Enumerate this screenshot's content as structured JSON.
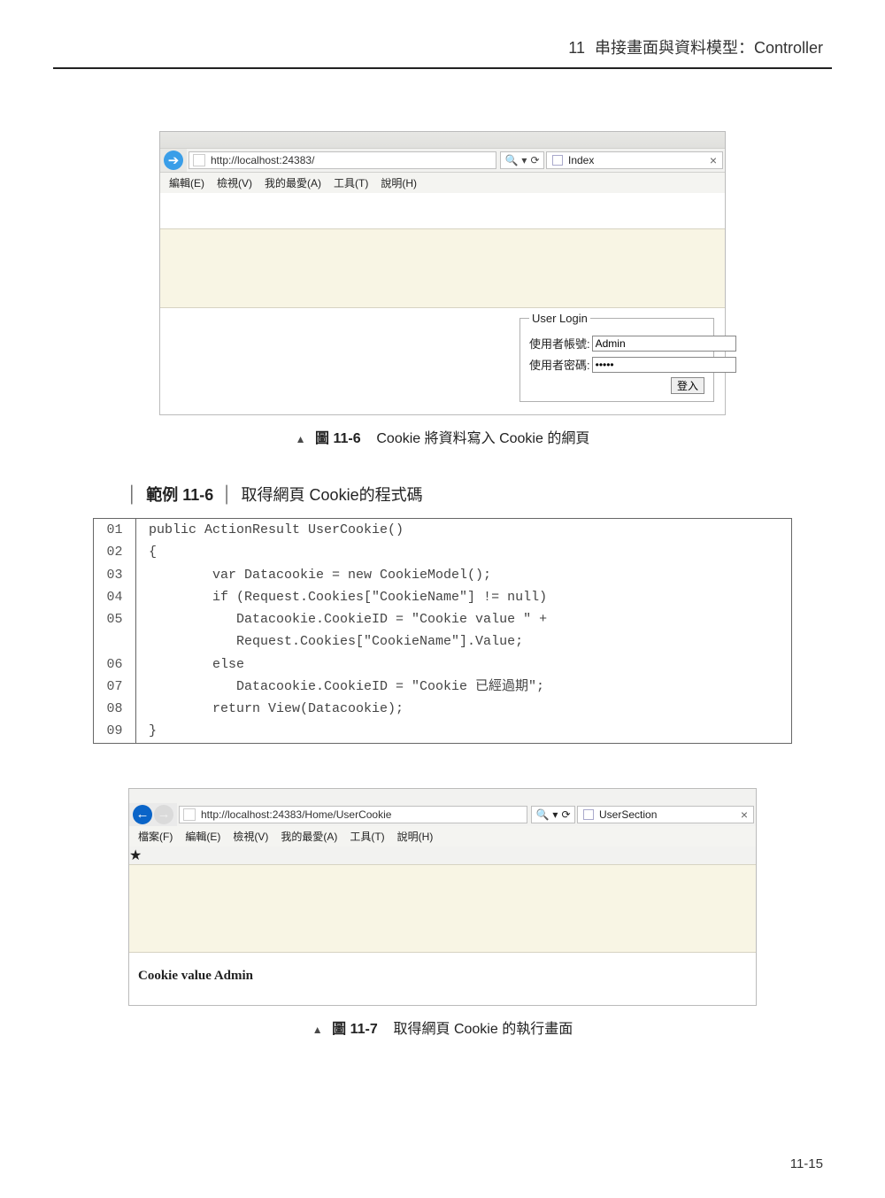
{
  "header": {
    "chapter_num": "11",
    "chapter_title": "串接畫面與資料模型：Controller"
  },
  "page_number": "11-15",
  "fig1": {
    "url_prefix": "http://",
    "url_host": "localhost",
    "url_rest": ":24383/",
    "search_refresh": "⟳",
    "tab_title": "Index",
    "menu": [
      "編輯(E)",
      "檢視(V)",
      "我的最愛(A)",
      "工具(T)",
      "說明(H)"
    ],
    "login_legend": "User Login",
    "label_user": "使用者帳號:",
    "label_pass": "使用者密碼:",
    "value_user": "Admin",
    "value_pass": "•••••",
    "login_button": "登入",
    "caption_label": "圖 11-6",
    "caption_text": "Cookie 將資料寫入 Cookie 的網頁"
  },
  "example": {
    "label": "範例 11-6",
    "title": "取得網頁 Cookie的程式碼"
  },
  "code": {
    "lines": [
      {
        "n": "01",
        "t": "public ActionResult UserCookie()"
      },
      {
        "n": "02",
        "t": "{"
      },
      {
        "n": "03",
        "t": "        var Datacookie = new CookieModel();"
      },
      {
        "n": "04",
        "t": "        if (Request.Cookies[\"CookieName\"] != null)"
      },
      {
        "n": "05",
        "t": "           Datacookie.CookieID = \"Cookie value \" +\n           Request.Cookies[\"CookieName\"].Value;"
      },
      {
        "n": "06",
        "t": "        else"
      },
      {
        "n": "07",
        "t": "           Datacookie.CookieID = \"Cookie 已經過期\";"
      },
      {
        "n": "08",
        "t": "        return View(Datacookie);"
      },
      {
        "n": "09",
        "t": "}"
      }
    ]
  },
  "fig2": {
    "url_prefix": "http://",
    "url_host": "localhost",
    "url_rest": ":24383/Home/UserCookie",
    "tab_title": "UserSection",
    "menu": [
      "檔案(F)",
      "編輯(E)",
      "檢視(V)",
      "我的最愛(A)",
      "工具(T)",
      "說明(H)"
    ],
    "result_text": "Cookie value Admin",
    "caption_label": "圖 11-7",
    "caption_text": "取得網頁 Cookie 的執行畫面"
  }
}
